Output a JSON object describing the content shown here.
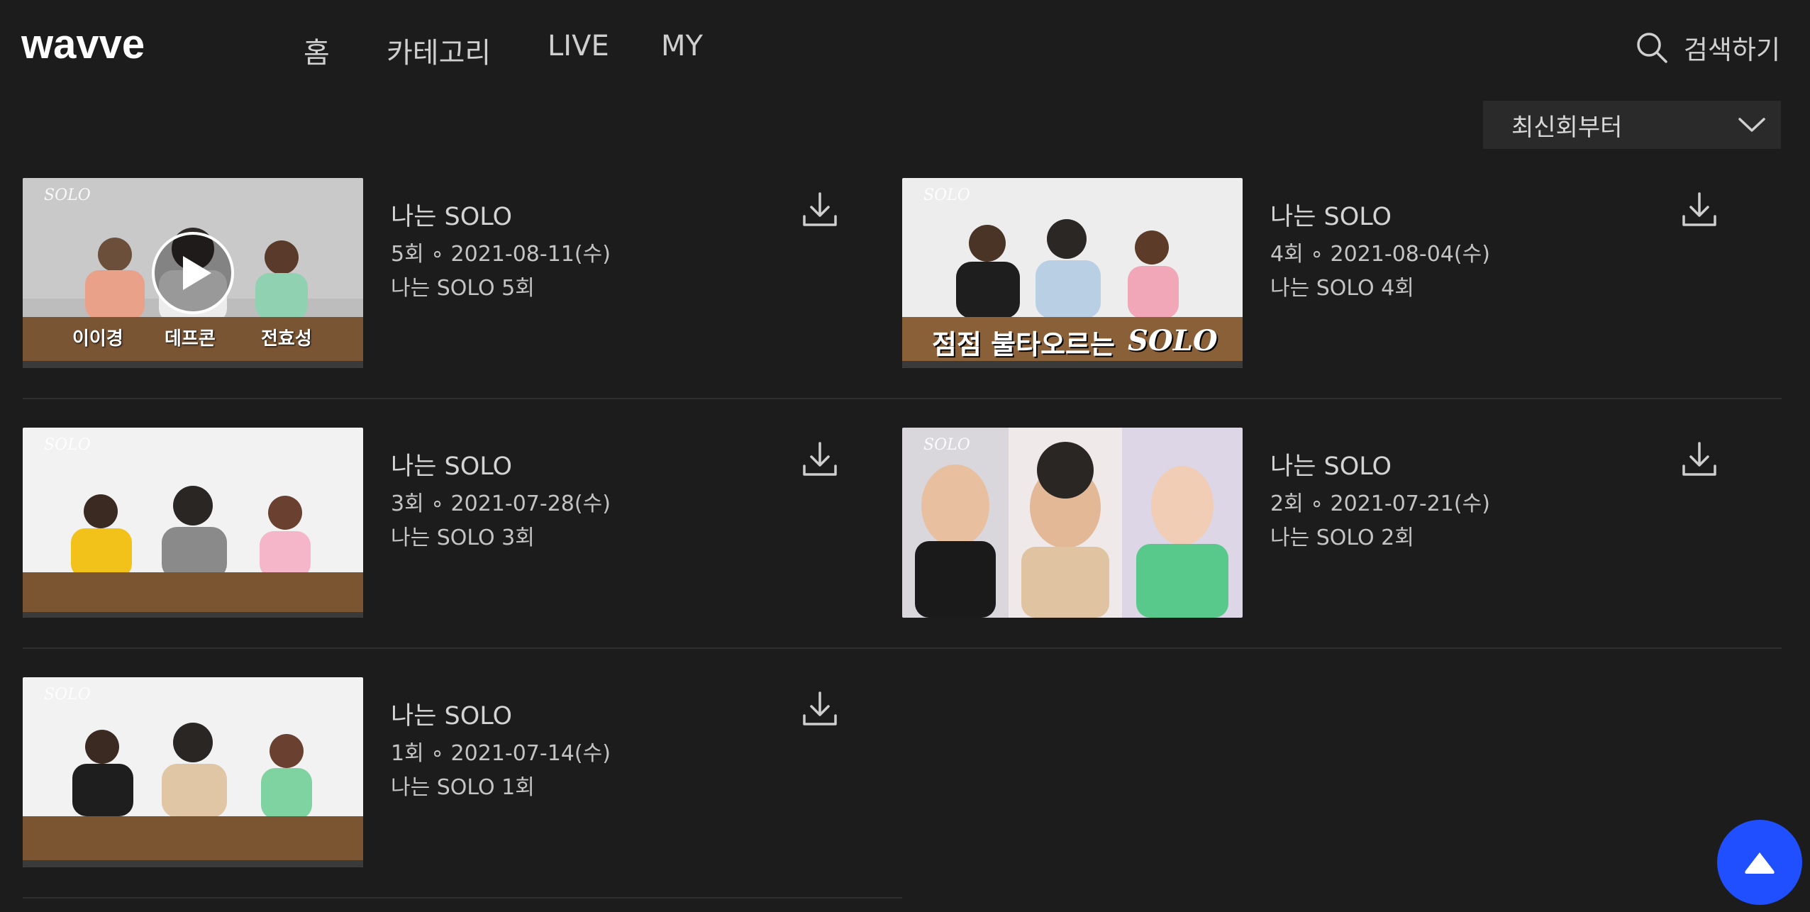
{
  "header": {
    "logo_text": "wavve",
    "nav": [
      "홈",
      "카테고리",
      "LIVE",
      "MY"
    ],
    "search_label": "검색하기"
  },
  "sort": {
    "selected": "최신회부터"
  },
  "thumb_brand": "SOLO",
  "episodes": [
    {
      "title": "나는 SOLO",
      "meta": "5회 ∘ 2021-08-11(수)",
      "desc": "나는 SOLO 5회",
      "thumb_names": [
        "이이경",
        "데프콘",
        "전효성"
      ]
    },
    {
      "title": "나는 SOLO",
      "meta": "4회 ∘ 2021-08-04(수)",
      "desc": "나는 SOLO 4회",
      "thumb_caption": "점점 불타오르는",
      "thumb_caption2": "SOLO"
    },
    {
      "title": "나는 SOLO",
      "meta": "3회 ∘ 2021-07-28(수)",
      "desc": "나는 SOLO 3회"
    },
    {
      "title": "나는 SOLO",
      "meta": "2회 ∘ 2021-07-21(수)",
      "desc": "나는 SOLO 2회"
    },
    {
      "title": "나는 SOLO",
      "meta": "1회 ∘ 2021-07-14(수)",
      "desc": "나는 SOLO 1회"
    }
  ],
  "colors": {
    "background": "#1c1c1c",
    "accent": "#1f4fff"
  }
}
